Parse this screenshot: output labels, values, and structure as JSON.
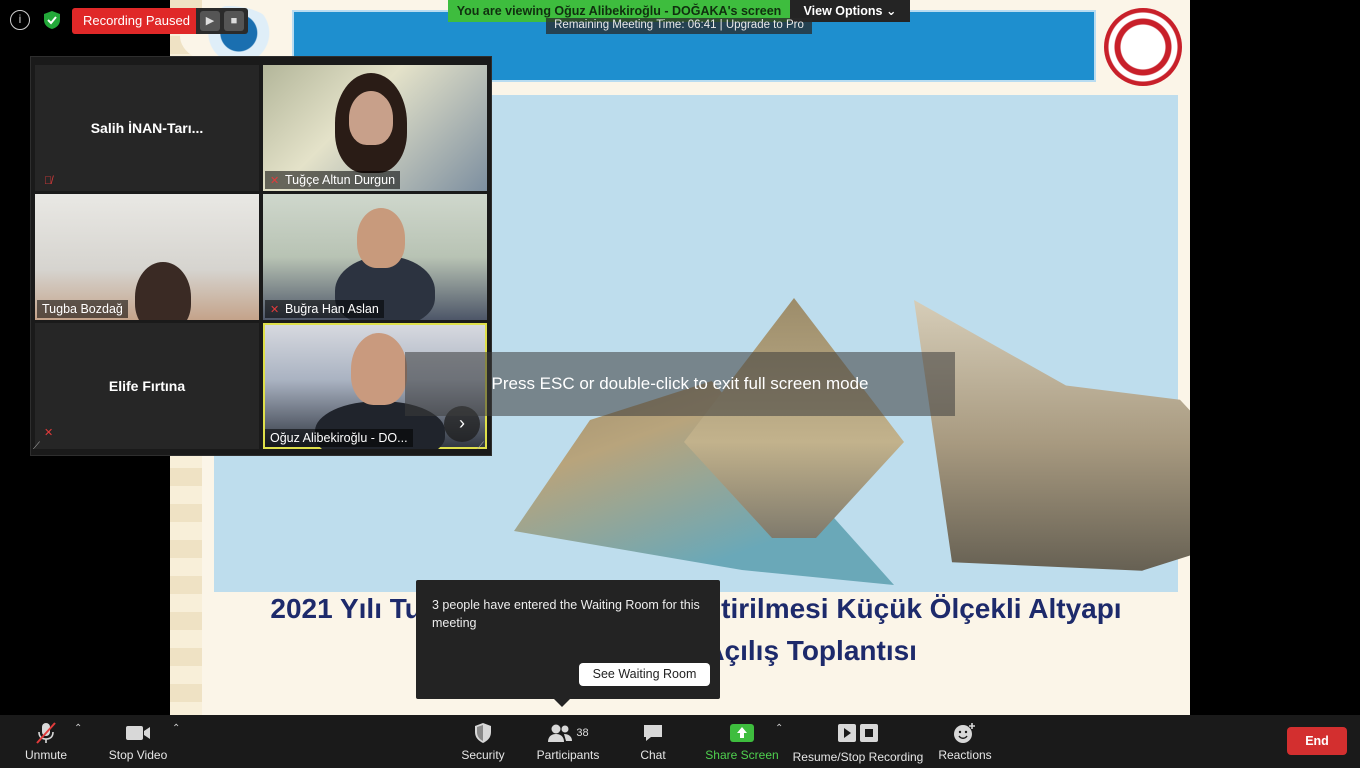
{
  "recording": {
    "status_label": "Recording Paused",
    "resume_symbol": "▶",
    "stop_symbol": "■"
  },
  "banner": {
    "viewing_text": "You are viewing Oğuz Alibekiroğlu - DOĞAKA's screen",
    "view_options_label": "View Options",
    "meeting_time_text": "Remaining Meeting Time: 06:41 | Upgrade to Pro"
  },
  "gallery": {
    "tiles": [
      {
        "name": "Salih  İNAN-Tarı...",
        "video": false,
        "muted": true
      },
      {
        "name": "Tuğçe Altun Durgun",
        "video": true,
        "muted": true
      },
      {
        "name": "Tugba Bozdağ",
        "video": true,
        "muted": false
      },
      {
        "name": "Buğra Han Aslan",
        "video": true,
        "muted": true
      },
      {
        "name": "Elife Fırtına",
        "video": false,
        "muted": true
      },
      {
        "name": "Oğuz Alibekiroğlu - DO...",
        "video": true,
        "muted": false,
        "active_speaker": true
      }
    ]
  },
  "slide": {
    "title_line1": "2021 Yılı Turizm Altyapısının Geliştirilmesi Küçük Ölçekli Altyapı",
    "title_line2": "Destek Programı Açılış Toplantısı"
  },
  "fullscreen_hint": "Press ESC or double-click to exit full screen mode",
  "waiting_room": {
    "message": "3 people have entered the Waiting Room for this meeting",
    "button_label": "See Waiting Room"
  },
  "toolbar": {
    "unmute_label": "Unmute",
    "stop_video_label": "Stop Video",
    "security_label": "Security",
    "participants_label": "Participants",
    "participants_count": "38",
    "chat_label": "Chat",
    "share_screen_label": "Share Screen",
    "resume_stop_recording_label": "Resume/Stop Recording",
    "reactions_label": "Reactions",
    "end_label": "End"
  },
  "colors": {
    "recording_red": "#e02828",
    "share_green": "#3ebd3e",
    "end_red": "#d32f2f",
    "active_speaker": "#dfe04a"
  }
}
